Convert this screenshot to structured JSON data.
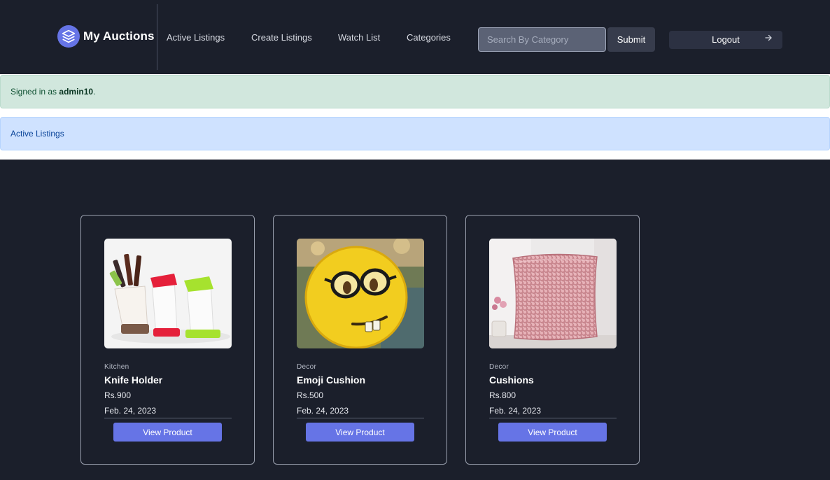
{
  "brand": {
    "name": "My Auctions",
    "icon": "layers-icon"
  },
  "nav": {
    "links": [
      {
        "label": "Active Listings"
      },
      {
        "label": "Create Listings"
      },
      {
        "label": "Watch List"
      },
      {
        "label": "Categories"
      }
    ],
    "search": {
      "placeholder": "Search By Category",
      "value": ""
    },
    "submit_label": "Submit",
    "logout_label": "Logout",
    "logout_icon": "arrow-right-icon"
  },
  "alerts": {
    "signed_in_prefix": "Signed in as ",
    "username": "admin10",
    "signed_in_suffix": ".",
    "section_title": "Active Listings"
  },
  "listings": [
    {
      "category": "Kitchen",
      "title": "Knife Holder",
      "price": "Rs.900",
      "date": "Feb. 24, 2023",
      "button": "View Product",
      "image": "knife-holder-image"
    },
    {
      "category": "Decor",
      "title": "Emoji Cushion",
      "price": "Rs.500",
      "date": "Feb. 24, 2023",
      "button": "View Product",
      "image": "emoji-cushion-image"
    },
    {
      "category": "Decor",
      "title": "Cushions",
      "price": "Rs.800",
      "date": "Feb. 24, 2023",
      "button": "View Product",
      "image": "sequin-cushion-image"
    }
  ],
  "colors": {
    "background": "#1b1f2b",
    "accent": "#6674e6",
    "success_bg": "#d1e7dd",
    "info_bg": "#cfe2ff"
  }
}
